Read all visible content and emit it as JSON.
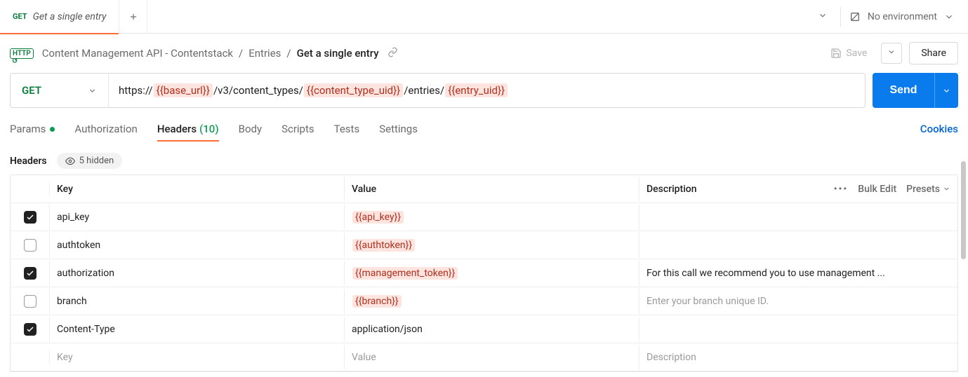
{
  "tab": {
    "method": "GET",
    "title": "Get a single entry"
  },
  "environment": {
    "label": "No environment"
  },
  "breadcrumb": {
    "collection": "Content Management API - Contentstack",
    "folder": "Entries",
    "request": "Get a single entry"
  },
  "actions": {
    "save": "Save",
    "share": "Share",
    "send": "Send",
    "cookies": "Cookies",
    "bulk_edit": "Bulk Edit",
    "presets": "Presets"
  },
  "request": {
    "method": "GET",
    "url": {
      "p0": "https://",
      "v0": "{{base_url}}",
      "p1": "/v3/content_types/",
      "v1": "{{content_type_uid}}",
      "p2": "/entries/",
      "v2": "{{entry_uid}}"
    }
  },
  "req_tabs": {
    "params": "Params",
    "authorization": "Authorization",
    "headers": "Headers",
    "headers_count": "(10)",
    "body": "Body",
    "scripts": "Scripts",
    "tests": "Tests",
    "settings": "Settings"
  },
  "headers_section": {
    "title": "Headers",
    "hidden_label": "5 hidden"
  },
  "table": {
    "head": {
      "key": "Key",
      "value": "Value",
      "description": "Description"
    },
    "placeholder": {
      "key": "Key",
      "value": "Value",
      "description": "Description"
    },
    "rows": [
      {
        "checked": true,
        "key": "api_key",
        "value": "{{api_key}}",
        "is_var": true,
        "description": ""
      },
      {
        "checked": false,
        "key": "authtoken",
        "value": "{{authtoken}}",
        "is_var": true,
        "description": ""
      },
      {
        "checked": true,
        "key": "authorization",
        "value": "{{management_token}}",
        "is_var": true,
        "description": "For this call we recommend you to use management ..."
      },
      {
        "checked": false,
        "key": "branch",
        "value": "{{branch}}",
        "is_var": true,
        "description": "Enter your branch unique ID.",
        "desc_placeholder": true
      },
      {
        "checked": true,
        "key": "Content-Type",
        "value": "application/json",
        "is_var": false,
        "description": ""
      }
    ]
  }
}
